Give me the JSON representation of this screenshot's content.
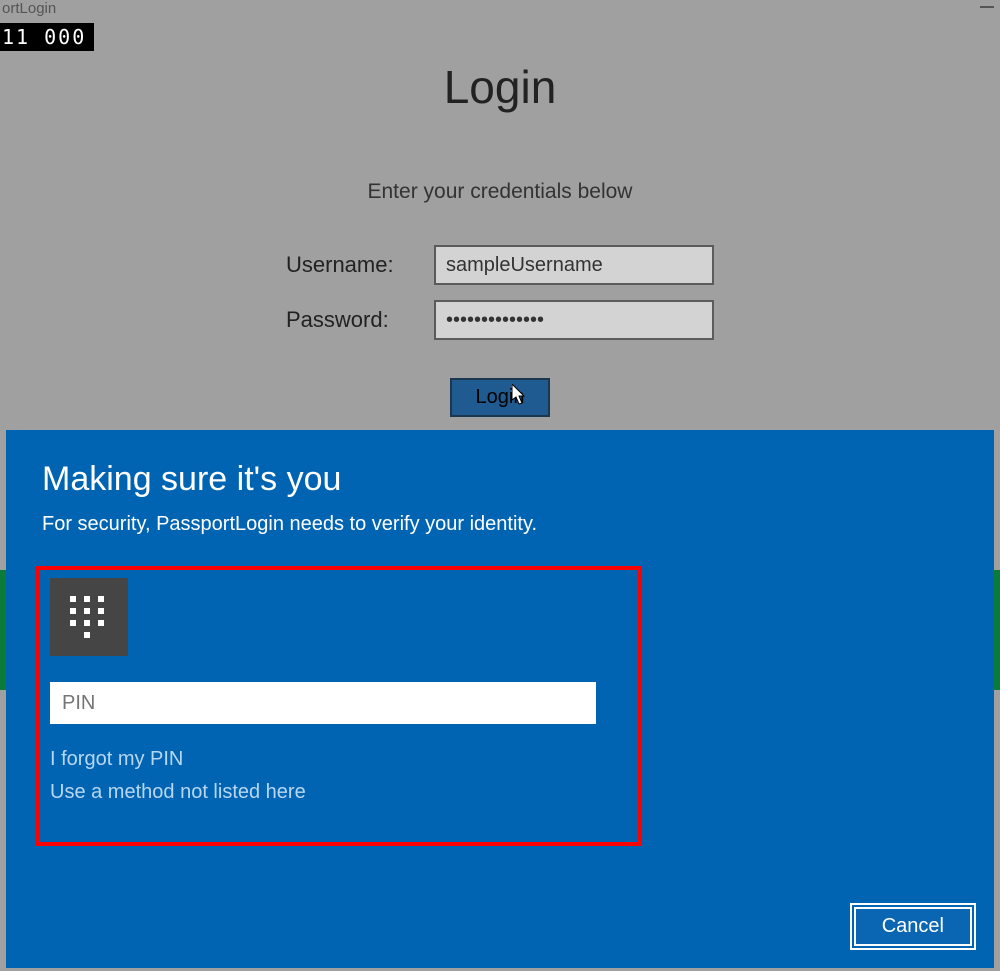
{
  "window": {
    "title_fragment": "ortLogin",
    "counter": "11   000"
  },
  "login": {
    "heading": "Login",
    "subheading": "Enter your credentials below",
    "username_label": "Username:",
    "username_value": "sampleUsername",
    "password_label": "Password:",
    "password_value": "••••••••••••••",
    "button_label": "Login"
  },
  "modal": {
    "title": "Making sure it's you",
    "subtitle": "For security, PassportLogin needs to verify your identity.",
    "pin_placeholder": "PIN",
    "forgot_link": "I forgot my PIN",
    "alt_method_link": "Use a method not listed here",
    "cancel_label": "Cancel"
  }
}
